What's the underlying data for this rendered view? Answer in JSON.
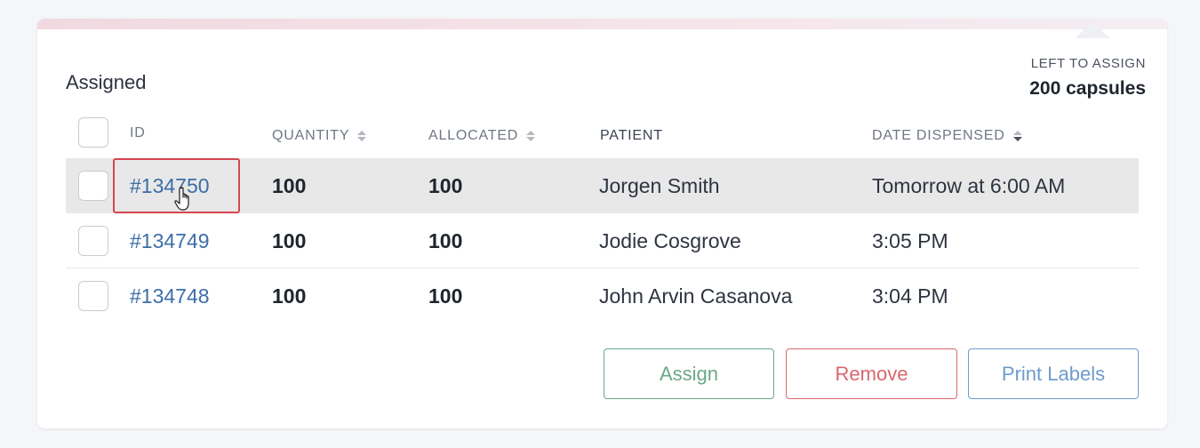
{
  "section": {
    "title": "Assigned"
  },
  "summary": {
    "label": "LEFT TO ASSIGN",
    "value": "200 capsules"
  },
  "table": {
    "headers": {
      "id": "ID",
      "quantity": "QUANTITY",
      "allocated": "ALLOCATED",
      "patient": "PATIENT",
      "date": "DATE DISPENSED"
    },
    "rows": [
      {
        "id": "#134750",
        "quantity": "100",
        "allocated": "100",
        "patient": "Jorgen Smith",
        "date": "Tomorrow at 6:00 AM",
        "highlighted": true
      },
      {
        "id": "#134749",
        "quantity": "100",
        "allocated": "100",
        "patient": "Jodie Cosgrove",
        "date": "3:05 PM",
        "highlighted": false
      },
      {
        "id": "#134748",
        "quantity": "100",
        "allocated": "100",
        "patient": "John Arvin Casanova",
        "date": "3:04 PM",
        "highlighted": false
      }
    ]
  },
  "actions": {
    "assign": "Assign",
    "remove": "Remove",
    "print": "Print Labels"
  },
  "colors": {
    "link": "#3c6ea8",
    "assign": "#6aa888",
    "remove": "#d9676d",
    "print": "#6f9ccc",
    "row_highlight": "#e8e8e8",
    "focus_outline": "#d64550"
  }
}
